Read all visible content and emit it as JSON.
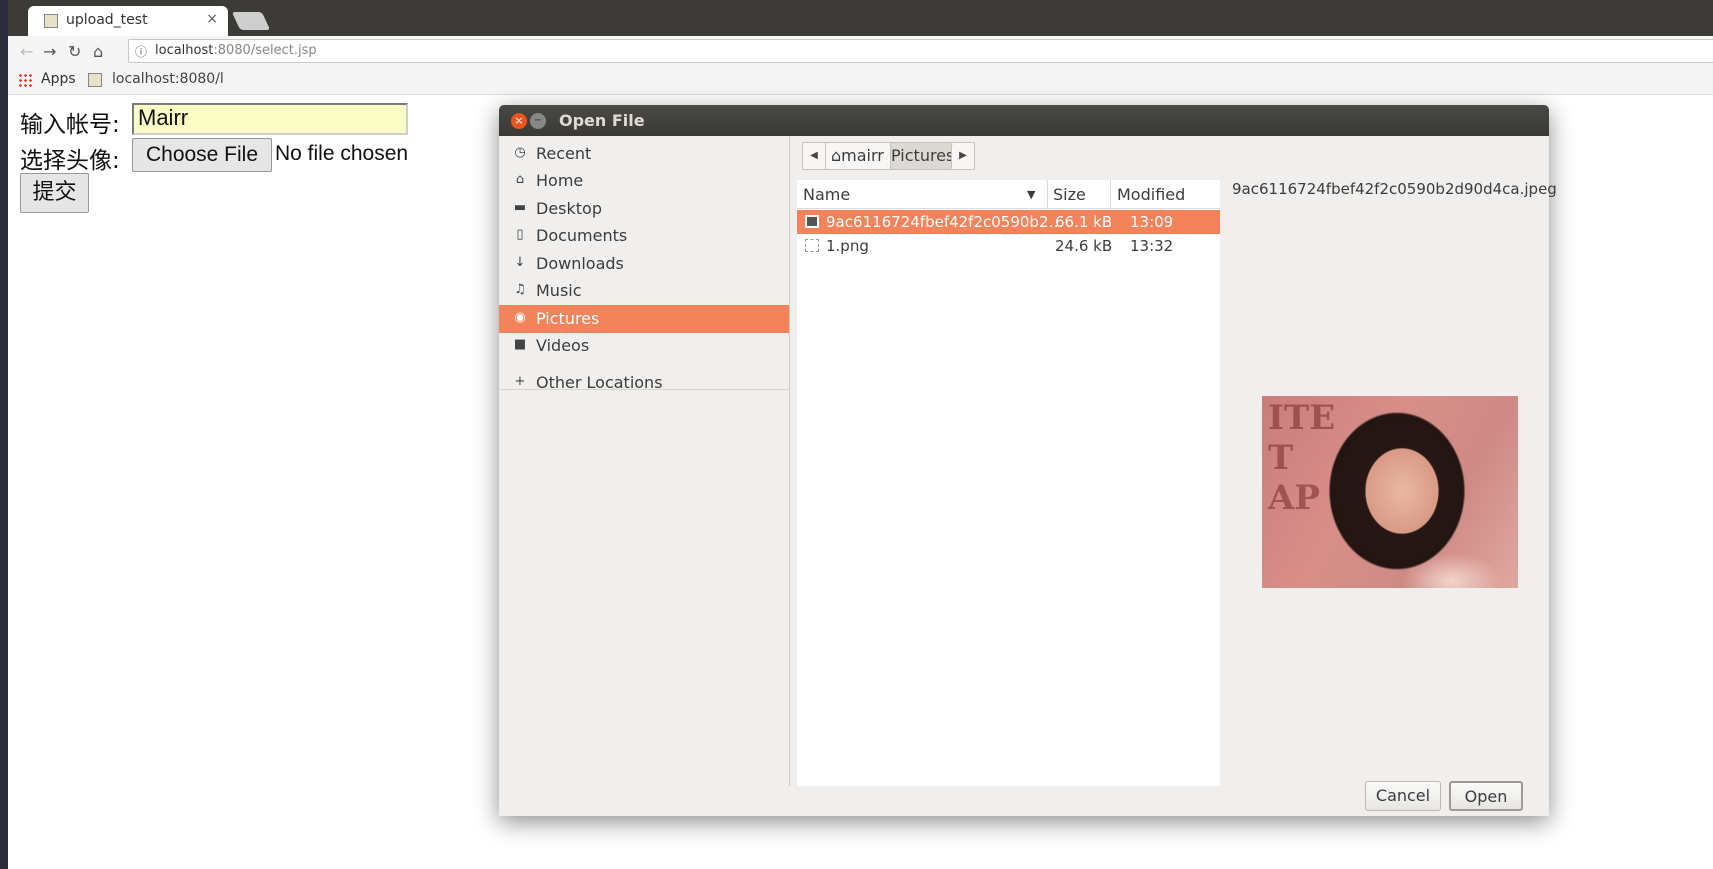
{
  "browser": {
    "tab_title": "upload_test",
    "tab_close": "×",
    "url_host": "localhost",
    "url_rest": ":8080/select.jsp",
    "bookmarks": {
      "apps": "Apps",
      "localhost": "localhost:8080/l"
    }
  },
  "page": {
    "account_label": "输入帐号:",
    "account_value": "Mairr",
    "avatar_label": "选择头像:",
    "choose_file": "Choose File",
    "no_file": "No file chosen",
    "submit": "提交"
  },
  "dialog": {
    "title": "Open File",
    "sidebar": [
      {
        "label": "Recent",
        "icon": "clock-icon"
      },
      {
        "label": "Home",
        "icon": "home-icon"
      },
      {
        "label": "Desktop",
        "icon": "folder-icon"
      },
      {
        "label": "Documents",
        "icon": "document-icon"
      },
      {
        "label": "Downloads",
        "icon": "download-icon"
      },
      {
        "label": "Music",
        "icon": "music-icon"
      },
      {
        "label": "Pictures",
        "icon": "camera-icon",
        "active": true
      },
      {
        "label": "Videos",
        "icon": "video-icon"
      },
      {
        "label": "Other Locations",
        "icon": "plus-icon"
      }
    ],
    "path": [
      "mairr",
      "Pictures"
    ],
    "columns": {
      "name": "Name",
      "size": "Size",
      "modified": "Modified"
    },
    "files": [
      {
        "name": "9ac6116724fbef42f2c0590b2…",
        "size": "66.1 kB",
        "modified": "13:09",
        "selected": true
      },
      {
        "name": "1.png",
        "size": "24.6 kB",
        "modified": "13:32",
        "selected": false
      }
    ],
    "preview_filename": "9ac6116724fbef42f2c0590b2d90d4ca.jpeg",
    "preview_wall_text": "ITE\nT\nAP",
    "cancel": "Cancel",
    "open": "Open",
    "accent_color": "#f3835b"
  }
}
